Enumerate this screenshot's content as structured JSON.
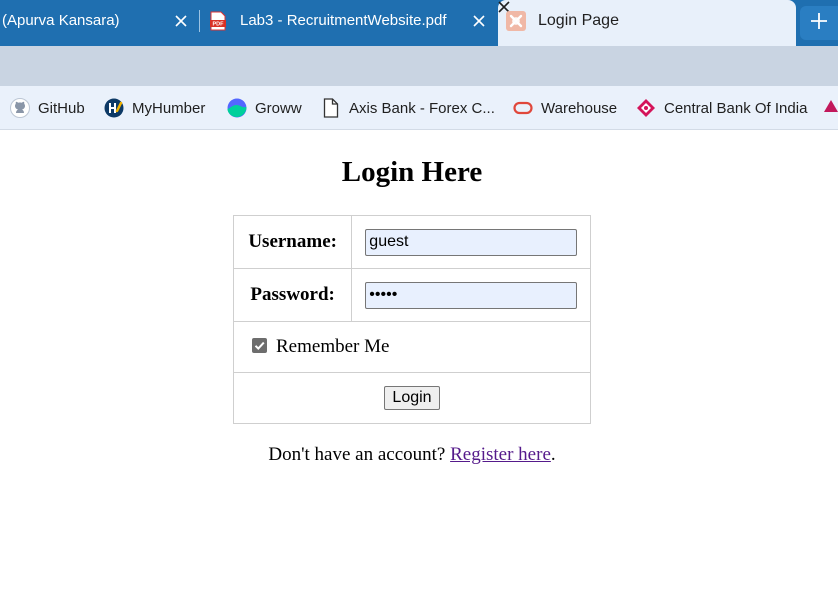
{
  "browser": {
    "tabs": [
      {
        "title": "(Apurva Kansara)",
        "favicon": "none"
      },
      {
        "title": "Lab3 - RecruitmentWebsite.pdf",
        "favicon": "pdf-icon"
      },
      {
        "title": "Login Page",
        "favicon": "xampp-icon",
        "active": true
      }
    ],
    "new_tab_icon": "plus-icon",
    "bookmarks": [
      {
        "label": "GitHub",
        "icon": "github-icon"
      },
      {
        "label": "MyHumber",
        "icon": "myhumber-icon"
      },
      {
        "label": "Groww",
        "icon": "groww-icon"
      },
      {
        "label": "Axis Bank - Forex C...",
        "icon": "document-icon"
      },
      {
        "label": "Warehouse",
        "icon": "oracle-icon"
      },
      {
        "label": "Central Bank Of India",
        "icon": "central-bank-icon"
      }
    ]
  },
  "page": {
    "heading": "Login Here",
    "username_label": "Username:",
    "username_value": "guest",
    "password_label": "Password:",
    "password_value": "•••••",
    "remember_label": "Remember Me",
    "remember_checked": true,
    "login_button": "Login",
    "register_prefix": "Don't have an account? ",
    "register_link": "Register here",
    "register_suffix": "."
  },
  "colors": {
    "tabstrip": "#1f6fb0",
    "active_tab": "#e8f0fa",
    "toolbar": "#c9d4e2",
    "link_visited": "#551a8b",
    "input_autofill": "#e8f0fe"
  }
}
